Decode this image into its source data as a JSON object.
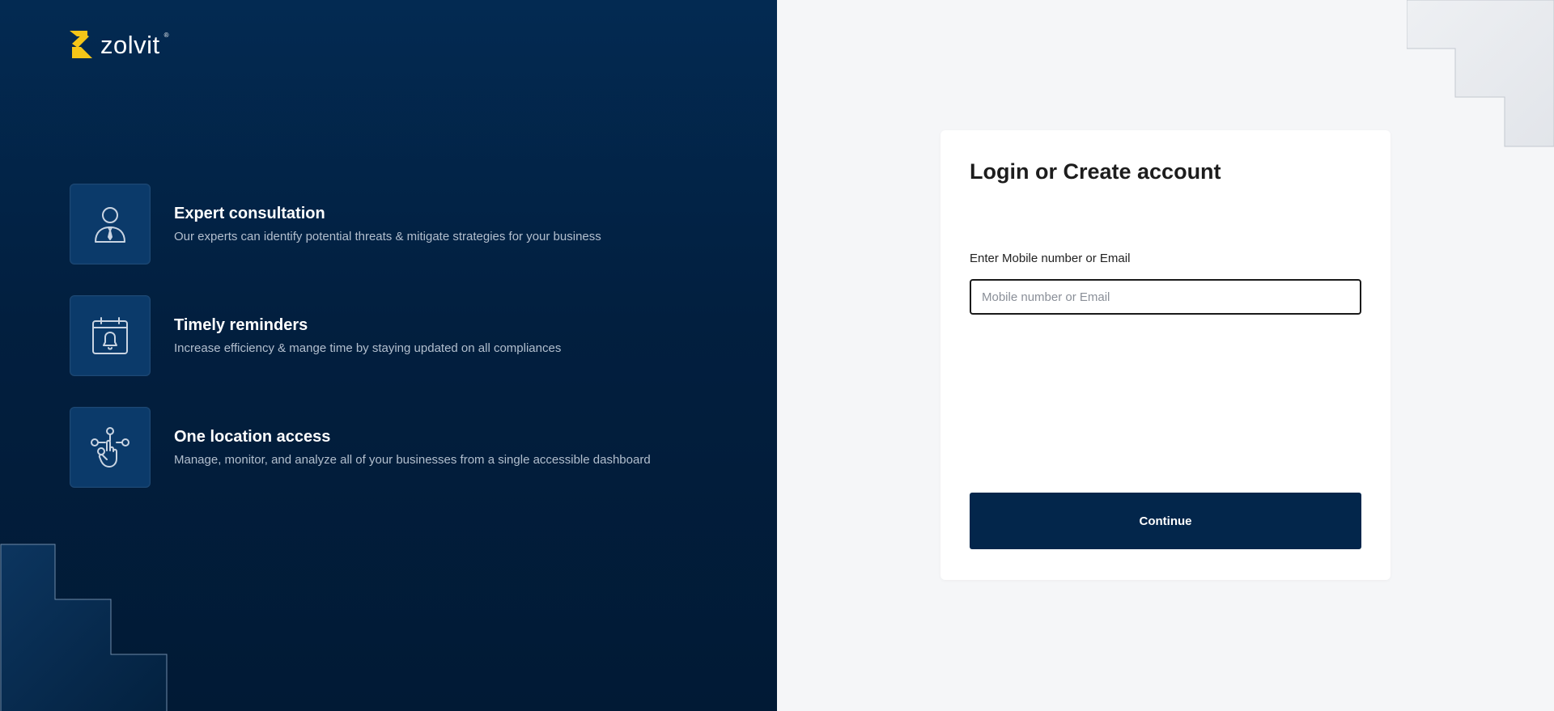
{
  "brand": {
    "name": "zolvit",
    "registered_mark": "®",
    "accent_color": "#f5c518",
    "panel_color": "#022449"
  },
  "features": [
    {
      "icon": "expert-person-icon",
      "title": "Expert consultation",
      "description": "Our experts can identify potential threats & mitigate strategies for your business"
    },
    {
      "icon": "calendar-bell-icon",
      "title": "Timely reminders",
      "description": "Increase efficiency & mange time by staying updated on all compliances"
    },
    {
      "icon": "hand-network-icon",
      "title": "One location access",
      "description": "Manage, monitor, and analyze all of your businesses from a single accessible dashboard"
    }
  ],
  "login": {
    "title": "Login or Create account",
    "field_label": "Enter Mobile number or Email",
    "field_placeholder": "Mobile number or Email",
    "field_value": "",
    "continue_label": "Continue",
    "button_color": "#03264b"
  }
}
